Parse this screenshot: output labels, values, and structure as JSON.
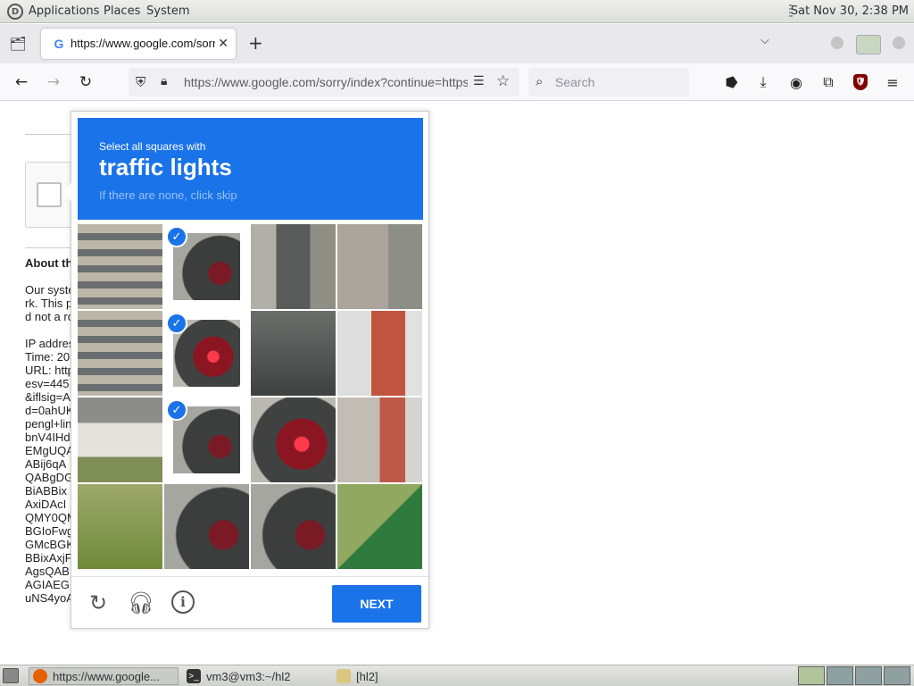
{
  "top_panel": {
    "menus": [
      "Applications",
      "Places",
      "System"
    ],
    "clock": "Sat Nov 30,  2:38 PM"
  },
  "browser": {
    "tab": {
      "title": "https://www.google.com/sorry/index?continue=https",
      "favicon": "G"
    },
    "url": "https://www.google.com/sorry/index?continue=https",
    "search": {
      "placeholder": "Search"
    },
    "ublock_badge": "2"
  },
  "page": {
    "about_heading": "About this page",
    "about_lines": [
      "Our systems have detected unusual traffic from your computer netwo",
      "rk. This page checks to see if it's really you sending the requests, an",
      "d not a robot.",
      "",
      "IP address:",
      "Time: 20",
      "URL: https",
      "esv=445",
      "&iflsig=A",
      "d=0ahUK",
      "pengl+lin",
      "bnV4IHd",
      "EMgUQA",
      "ABij6qA",
      "QABgDG",
      "BiABBix",
      "AxiDAcI",
      "QMY0QM",
      "BGIoFwg",
      "GMcBGK",
      "BBixAxjF",
      "AgsQAB",
      "AGIAEG",
      "uNS4yoA"
    ]
  },
  "captcha": {
    "prompt_small": "Select all squares with",
    "prompt_target": "traffic lights",
    "prompt_hint": "If there are none, click skip",
    "selected_tiles": [
      1,
      5,
      9
    ],
    "next_label": "NEXT",
    "icons": {
      "reload": "reload-icon",
      "audio": "headphones-icon",
      "info": "info-icon"
    }
  },
  "taskbar": {
    "tasks": [
      {
        "label": "https://www.google...",
        "icon": "firefox-icon"
      },
      {
        "label": "vm3@vm3:~/hl2",
        "icon": "terminal-icon"
      },
      {
        "label": "[hl2]",
        "icon": "folder-icon"
      }
    ]
  }
}
